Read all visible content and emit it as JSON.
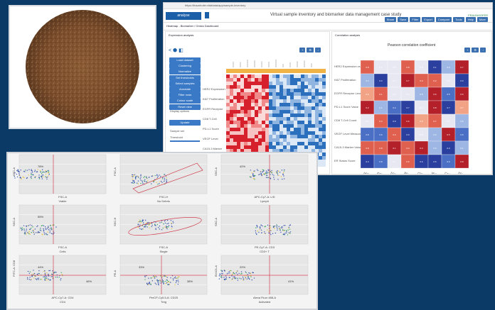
{
  "browser": {
    "url": "https://fraunhofer.vitaldata/app/sample-inventory"
  },
  "app": {
    "logo": "analyse",
    "title": "Virtual sample inventory and biomarker data management case study",
    "brand": "FRAUNHOFER"
  },
  "toolbar": {
    "buttons": [
      "Share",
      "Save",
      "Filter",
      "Export",
      "Compare",
      "Tools",
      "Help",
      "More"
    ]
  },
  "tabs": {
    "active": "Heatmap - Biomarker / Omics Dashboard"
  },
  "left_panel": {
    "title": "Expression analysis",
    "buttons": [
      "Load dataset",
      "Clustering",
      "Normalize",
      "Set thresholds",
      "Select samples",
      "Annotate",
      "Filter rows",
      "Colour scale",
      "Reset view"
    ],
    "sidebar_labels": [
      "Display options",
      "Sample set"
    ],
    "slider_label": "Threshold",
    "run_label": "Update"
  },
  "row_labels": [
    "HER2 Expression",
    "Ki67 Proliferation",
    "EGFR Receptor",
    "CD8 T-Cell",
    "PD-L1 Score",
    "VEGF Level",
    "CA15-3 Marker",
    "ER Status",
    "PR Status"
  ],
  "right_panel": {
    "title": "Correlation analysis",
    "subtitle": "Pearson correlation coefficient",
    "row_labels": [
      "HER2 Expression vs",
      "Ki67 Proliferation",
      "EGFR Receptor Level",
      "PD-L1 Score Value",
      "CD8 T-Cell Count",
      "VEGF Level Measure",
      "CA15-3 Marker Value",
      "ER Status Score"
    ],
    "col_labels": [
      "HER2",
      "Ki67",
      "EGFR",
      "PD-L1",
      "CD8",
      "VEGF",
      "CA15-3",
      "ER"
    ]
  },
  "flow": {
    "plots": [
      {
        "xlabel": "FSC-A",
        "title": "Viable",
        "pct": "78%",
        "ylabel": "SSC-A"
      },
      {
        "xlabel": "FSC-H",
        "title": "No Debris",
        "pct": "",
        "ylabel": "FSC-A"
      },
      {
        "xlabel": "APC-Cy7-A: L/D",
        "title": "Lymph",
        "pct": "42%",
        "ylabel": "SSC-A"
      },
      {
        "xlabel": "FSC-A",
        "title": "Cells",
        "pct": "55%",
        "ylabel": "SSC-A"
      },
      {
        "xlabel": "FSC-A",
        "title": "Single",
        "pct": "",
        "ylabel": "SSC-H"
      },
      {
        "xlabel": "PE-Cy7-A: CD3",
        "title": "CD3+ T",
        "pct": "",
        "ylabel": "SSC-A"
      },
      {
        "xlabel": "APC-Cy7-A: CD4",
        "title": "CD4",
        "pct": "44%",
        "ylabel": "FITC-A: CD8"
      },
      {
        "xlabel": "PerCP-Cy5.5-A: CD25",
        "title": "Treg",
        "pct": "33%",
        "ylabel": "PE-A"
      },
      {
        "xlabel": "Alexa Fluor 488-A",
        "title": "Activated",
        "pct": "22%",
        "ylabel": "BV421-A"
      }
    ],
    "extra_pcts": [
      "46%",
      "38%",
      "41%"
    ]
  },
  "colors": {
    "navy_bg": "#0b3a66",
    "accent": "#3a79c6"
  }
}
